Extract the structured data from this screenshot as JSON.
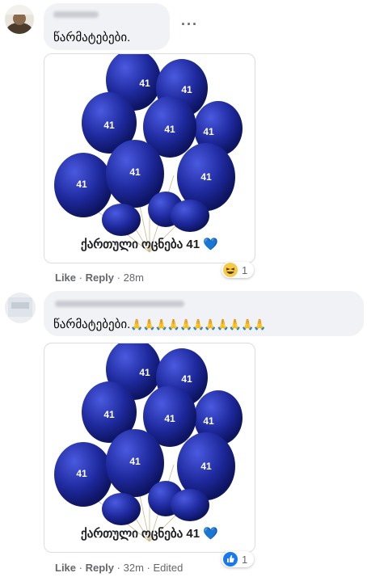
{
  "comments": [
    {
      "text": "წარმატებები.",
      "has_menu": true,
      "menu_label": "···",
      "image_balloon_label": "41",
      "image_caption": "ქართული ოცნება 41",
      "image_heart": "💙",
      "like_label": "Like",
      "reply_label": "Reply",
      "separator": "·",
      "time": "28m",
      "reaction_icon": "haha-icon",
      "reaction_count": "1"
    },
    {
      "text": "წარმატებები.",
      "emoji_suffix": "🙏🙏🙏🙏🙏🙏🙏🙏🙏🙏🙏",
      "image_balloon_label": "41",
      "image_caption": "ქართული ოცნება 41",
      "image_heart": "💙",
      "like_label": "Like",
      "reply_label": "Reply",
      "separator": "·",
      "time": "32m",
      "edited_label": "Edited",
      "reaction_icon": "like-icon",
      "reaction_count": "1"
    }
  ],
  "colors": {
    "bubble": "#f0f2f5",
    "meta": "#65676b",
    "balloon": "#1f2a9e",
    "like_blue": "#1877f2"
  }
}
